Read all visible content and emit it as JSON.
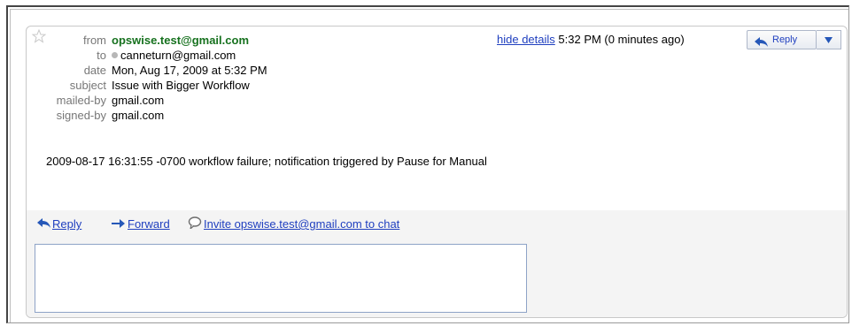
{
  "email": {
    "from_label": "from",
    "from_value": "opswise.test@gmail.com",
    "to_label": "to",
    "to_value": "canneturn@gmail.com",
    "date_label": "date",
    "date_value": "Mon, Aug 17, 2009 at 5:32 PM",
    "subject_label": "subject",
    "subject_value": "Issue with Bigger Workflow",
    "mailedby_label": "mailed-by",
    "mailedby_value": "gmail.com",
    "signedby_label": "signed-by",
    "signedby_value": "gmail.com",
    "hide_details": "hide details",
    "time": "5:32 PM (0 minutes ago)",
    "reply_button": "Reply",
    "body": "2009-08-17 16:31:55 -0700  workflow failure; notification triggered by Pause for Manual"
  },
  "actions": {
    "reply": "Reply",
    "forward": "Forward",
    "invite": "Invite opswise.test@gmail.com to chat"
  },
  "icons": {
    "star": "star-icon",
    "reply": "reply-arrow-icon",
    "forward": "forward-arrow-icon",
    "chat": "chat-bubble-icon",
    "dropdown": "triangle-down-icon"
  },
  "colors": {
    "link": "#1f3fbf",
    "sender": "#16711e",
    "label": "#777777",
    "footer_bg": "#f4f4f4"
  }
}
